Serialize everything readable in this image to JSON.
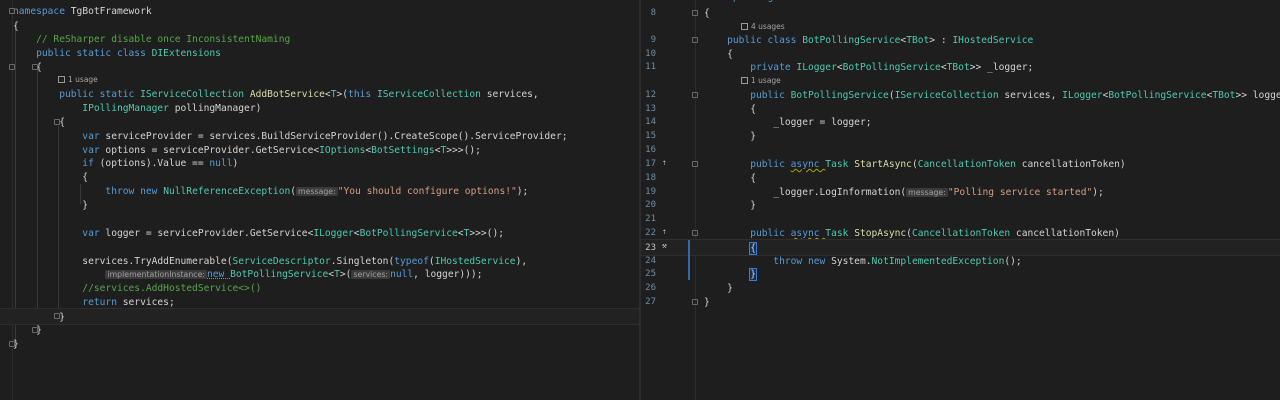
{
  "left_pane": {
    "lines": [
      [
        {
          "c": "kw",
          "t": "namespace "
        },
        {
          "c": "pl",
          "t": "TgBotFramework"
        }
      ],
      [
        {
          "c": "pl",
          "t": "{"
        }
      ],
      [
        {
          "c": "cm",
          "t": "    // ReSharper disable once InconsistentNaming"
        }
      ],
      [
        {
          "c": "kw",
          "t": "    public static class "
        },
        {
          "c": "ty",
          "t": "DIExtensions"
        }
      ],
      [
        {
          "c": "pl",
          "t": "    {"
        }
      ],
      [
        {
          "c": "kw",
          "t": "        public static "
        },
        {
          "c": "ty",
          "t": "IServiceCollection "
        },
        {
          "c": "fn",
          "t": "AddBotService"
        },
        {
          "c": "pl",
          "t": "<"
        },
        {
          "c": "ty",
          "t": "T"
        },
        {
          "c": "pl",
          "t": ">("
        },
        {
          "c": "kw",
          "t": "this "
        },
        {
          "c": "ty",
          "t": "IServiceCollection "
        },
        {
          "c": "pl",
          "t": "services,"
        }
      ],
      [
        {
          "c": "ty",
          "t": "            IPollingManager "
        },
        {
          "c": "pl",
          "t": "pollingManager)"
        }
      ],
      [
        {
          "c": "pl",
          "t": "        {"
        }
      ],
      [
        {
          "c": "kw",
          "t": "            var "
        },
        {
          "c": "pl",
          "t": "serviceProvider = services.BuildServiceProvider().CreateScope().ServiceProvider;"
        }
      ],
      [
        {
          "c": "kw",
          "t": "            var "
        },
        {
          "c": "pl",
          "t": "options = serviceProvider.GetService<"
        },
        {
          "c": "ty",
          "t": "IOptions"
        },
        {
          "c": "pl",
          "t": "<"
        },
        {
          "c": "ty",
          "t": "BotSettings"
        },
        {
          "c": "pl",
          "t": "<"
        },
        {
          "c": "ty",
          "t": "T"
        },
        {
          "c": "pl",
          "t": ">>>();"
        }
      ],
      [
        {
          "c": "kw",
          "t": "            if "
        },
        {
          "c": "pl",
          "t": "(options).Value == "
        },
        {
          "c": "kw",
          "t": "null"
        },
        {
          "c": "pl",
          "t": ")"
        }
      ],
      [
        {
          "c": "pl",
          "t": "            {"
        }
      ],
      [
        {
          "c": "kw",
          "t": "                throw new "
        },
        {
          "c": "ty",
          "t": "NullReferenceException"
        },
        {
          "c": "pl",
          "t": "("
        },
        {
          "c": "hint",
          "t": "message:"
        },
        {
          "c": "st",
          "t": "\"You should configure options!\""
        },
        {
          "c": "pl",
          "t": ");"
        }
      ],
      [
        {
          "c": "pl",
          "t": "            }"
        }
      ],
      [],
      [
        {
          "c": "kw",
          "t": "            var "
        },
        {
          "c": "pl",
          "t": "logger = serviceProvider.GetService<"
        },
        {
          "c": "ty",
          "t": "ILogger"
        },
        {
          "c": "pl",
          "t": "<"
        },
        {
          "c": "ty",
          "t": "BotPollingService"
        },
        {
          "c": "pl",
          "t": "<"
        },
        {
          "c": "ty",
          "t": "T"
        },
        {
          "c": "pl",
          "t": ">>>();"
        }
      ],
      [],
      [
        {
          "c": "pl",
          "t": "            services.TryAddEnumerable("
        },
        {
          "c": "ty",
          "t": "ServiceDescriptor"
        },
        {
          "c": "pl",
          "t": ".Singleton("
        },
        {
          "c": "kw",
          "t": "typeof"
        },
        {
          "c": "pl",
          "t": "("
        },
        {
          "c": "ty",
          "t": "IHostedService"
        },
        {
          "c": "pl",
          "t": "),"
        }
      ],
      [
        {
          "c": "pl",
          "t": "                "
        },
        {
          "c": "hint",
          "t": "implementationInstance:"
        },
        {
          "c": "kw",
          "t": "new "
        },
        {
          "c": "ty",
          "t": "BotPollingService"
        },
        {
          "c": "pl",
          "t": "<"
        },
        {
          "c": "ty",
          "t": "T"
        },
        {
          "c": "pl",
          "t": ">("
        },
        {
          "c": "hint",
          "t": "services:"
        },
        {
          "c": "kw",
          "t": "null"
        },
        {
          "c": "pl",
          "t": ", logger)));"
        }
      ],
      [
        {
          "c": "cm",
          "t": "            //services.AddHostedService<>()"
        }
      ],
      [
        {
          "c": "kw",
          "t": "            return "
        },
        {
          "c": "pl",
          "t": "services;"
        }
      ],
      [
        {
          "c": "pl",
          "t": "        }"
        }
      ],
      [
        {
          "c": "pl",
          "t": "    }"
        }
      ],
      [
        {
          "c": "pl",
          "t": "}"
        }
      ]
    ],
    "hints": {
      "usages_1": "1 usage"
    }
  },
  "right_pane": {
    "line_numbers": [
      "8",
      "9",
      "10",
      "11",
      "12",
      "13",
      "14",
      "15",
      "16",
      "17",
      "18",
      "19",
      "20",
      "21",
      "22",
      "23",
      "24",
      "25",
      "26",
      "27"
    ],
    "top_cut": "namespace TgBotFramework",
    "lines": [
      [
        {
          "c": "pl",
          "t": "{"
        }
      ],
      [
        {
          "c": "kw",
          "t": "    public class "
        },
        {
          "c": "ty",
          "t": "BotPollingService"
        },
        {
          "c": "pl",
          "t": "<"
        },
        {
          "c": "ty",
          "t": "TBot"
        },
        {
          "c": "pl",
          "t": "> : "
        },
        {
          "c": "ty",
          "t": "IHostedService"
        }
      ],
      [
        {
          "c": "pl",
          "t": "    {"
        }
      ],
      [
        {
          "c": "kw",
          "t": "        private "
        },
        {
          "c": "ty",
          "t": "ILogger"
        },
        {
          "c": "pl",
          "t": "<"
        },
        {
          "c": "ty",
          "t": "BotPollingService"
        },
        {
          "c": "pl",
          "t": "<"
        },
        {
          "c": "ty",
          "t": "TBot"
        },
        {
          "c": "pl",
          "t": ">> _logger;"
        }
      ],
      [
        {
          "c": "kw",
          "t": "        public "
        },
        {
          "c": "ty",
          "t": "BotPollingService"
        },
        {
          "c": "pl",
          "t": "("
        },
        {
          "c": "ty",
          "t": "IServiceCollection "
        },
        {
          "c": "pl",
          "t": "services, "
        },
        {
          "c": "ty",
          "t": "ILogger"
        },
        {
          "c": "pl",
          "t": "<"
        },
        {
          "c": "ty",
          "t": "BotPollingService"
        },
        {
          "c": "pl",
          "t": "<"
        },
        {
          "c": "ty",
          "t": "TBot"
        },
        {
          "c": "pl",
          "t": ">> logger)"
        }
      ],
      [
        {
          "c": "pl",
          "t": "        {"
        }
      ],
      [
        {
          "c": "pl",
          "t": "            _logger = logger;"
        }
      ],
      [
        {
          "c": "pl",
          "t": "        }"
        }
      ],
      [],
      [
        {
          "c": "kw",
          "t": "        public "
        },
        {
          "c": "kw",
          "t": "async "
        },
        {
          "c": "ty",
          "t": "Task "
        },
        {
          "c": "fn",
          "t": "StartAsync"
        },
        {
          "c": "pl",
          "t": "("
        },
        {
          "c": "ty",
          "t": "CancellationToken "
        },
        {
          "c": "pl",
          "t": "cancellationToken)"
        }
      ],
      [
        {
          "c": "pl",
          "t": "        {"
        }
      ],
      [
        {
          "c": "pl",
          "t": "            _logger.LogInformation("
        },
        {
          "c": "hint",
          "t": "message:"
        },
        {
          "c": "st",
          "t": "\"Polling service started\""
        },
        {
          "c": "pl",
          "t": ");"
        }
      ],
      [
        {
          "c": "pl",
          "t": "        }"
        }
      ],
      [],
      [
        {
          "c": "kw",
          "t": "        public "
        },
        {
          "c": "kw",
          "t": "async "
        },
        {
          "c": "ty",
          "t": "Task "
        },
        {
          "c": "fn",
          "t": "StopAsync"
        },
        {
          "c": "pl",
          "t": "("
        },
        {
          "c": "ty",
          "t": "CancellationToken "
        },
        {
          "c": "pl",
          "t": "cancellationToken)"
        }
      ],
      [
        {
          "c": "pl",
          "t": "        "
        },
        {
          "c": "pl",
          "t": "{"
        }
      ],
      [
        {
          "c": "kw",
          "t": "            throw new "
        },
        {
          "c": "pl",
          "t": "System."
        },
        {
          "c": "ty",
          "t": "NotImplementedException"
        },
        {
          "c": "pl",
          "t": "();"
        }
      ],
      [
        {
          "c": "pl",
          "t": "        "
        },
        {
          "c": "pl",
          "t": "}"
        }
      ],
      [
        {
          "c": "pl",
          "t": "    }"
        }
      ],
      [
        {
          "c": "pl",
          "t": "}"
        }
      ]
    ],
    "hints": {
      "usages_4": "4 usages",
      "usages_1": "1 usage"
    }
  }
}
